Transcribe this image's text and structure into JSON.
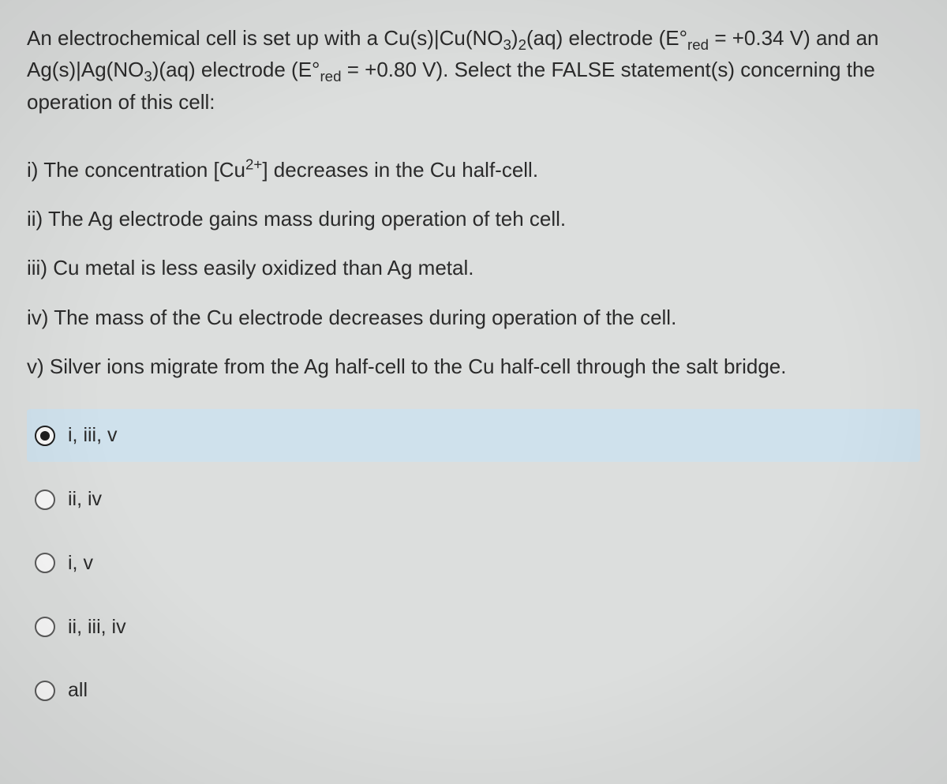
{
  "question": {
    "intro_html": "An electrochemical cell is set up with a Cu(s)|Cu(NO<sub>3</sub>)<sub>2</sub>(aq) electrode (E°<sub>red</sub> = +0.34 V) and an Ag(s)|Ag(NO<sub>3</sub>)(aq) electrode (E°<sub>red</sub> = +0.80 V). Select the FALSE statement(s) concerning the operation of this cell:"
  },
  "statements": [
    "i) The concentration [Cu<sup>2+</sup>] decreases in the Cu half-cell.",
    "ii) The Ag electrode gains mass during operation of teh cell.",
    "iii) Cu metal is less easily oxidized than Ag metal.",
    "iv) The mass of the Cu electrode decreases during operation of the cell.",
    "v) Silver ions migrate from the Ag half-cell to the Cu half-cell through the salt bridge."
  ],
  "options": [
    {
      "label": "i, iii, v",
      "selected": true
    },
    {
      "label": "ii, iv",
      "selected": false
    },
    {
      "label": "i, v",
      "selected": false
    },
    {
      "label": "ii, iii, iv",
      "selected": false
    },
    {
      "label": "all",
      "selected": false
    }
  ]
}
